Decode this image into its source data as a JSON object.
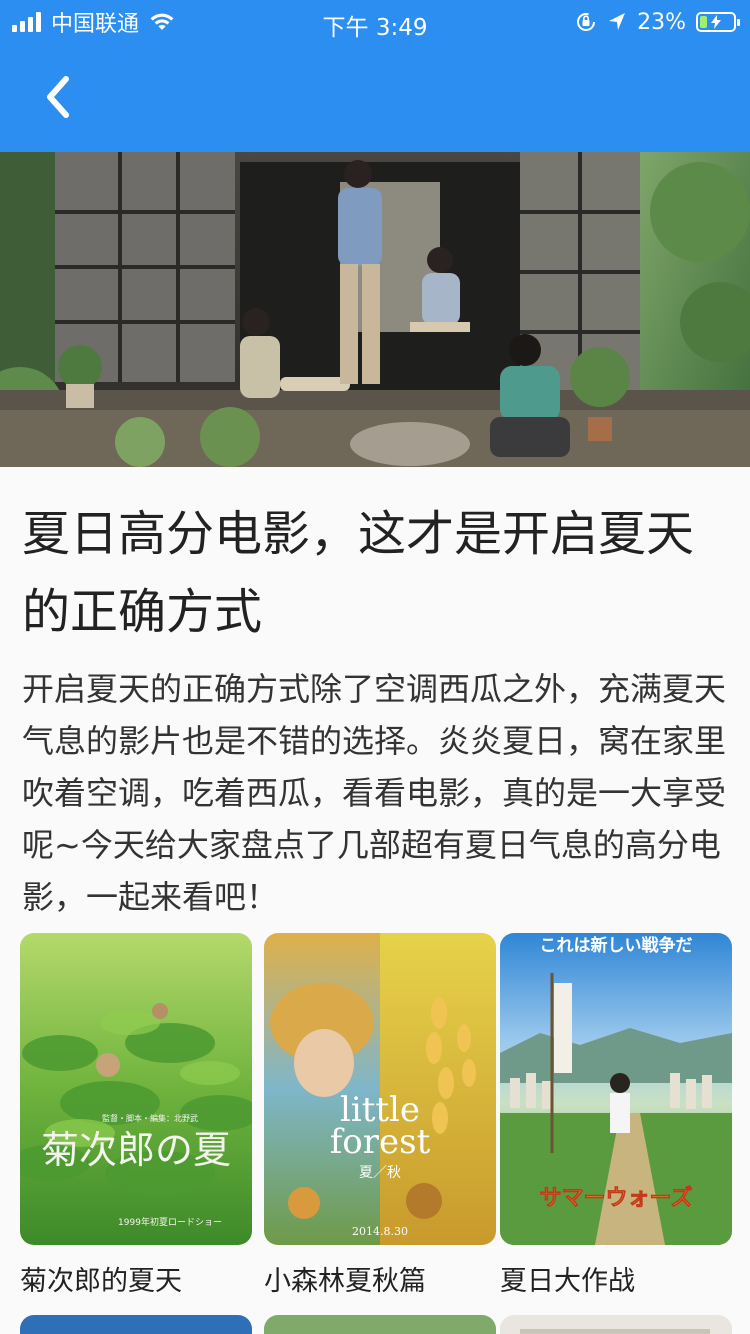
{
  "status_bar": {
    "carrier": "中国联通",
    "time": "下午 3:49",
    "battery_percent": "23%",
    "battery_level": 0.23,
    "icons": [
      "signal-icon",
      "wifi-icon",
      "rotation-lock-icon",
      "location-arrow-icon",
      "battery-charging-icon"
    ]
  },
  "nav": {
    "back_icon": "chevron-left-icon",
    "background_color": "#2b8ef0"
  },
  "article": {
    "title": "夏日高分电影，这才是开启夏天的正确方式",
    "description": "开启夏天的正确方式除了空调西瓜之外，充满夏天气息的影片也是不错的选择。炎炎夏日，窝在家里吹着空调，吃着西瓜，看看电影，真的是一大享受呢~今天给大家盘点了几部超有夏日气息的高分电影，一起来看吧！"
  },
  "movies": [
    {
      "label": "菊次郎的夏天",
      "poster_text": [
        "菊次郎の夏",
        "1999年初夏ロードショー",
        "監督・脚本・編集：北野武"
      ]
    },
    {
      "label": "小森林夏秋篇",
      "poster_text": [
        "little",
        "forest",
        "夏／秋",
        "2014.8.30"
      ]
    },
    {
      "label": "夏日大作战",
      "poster_text": [
        "これは新しい戦争だ",
        "サマーウォーズ"
      ]
    }
  ]
}
